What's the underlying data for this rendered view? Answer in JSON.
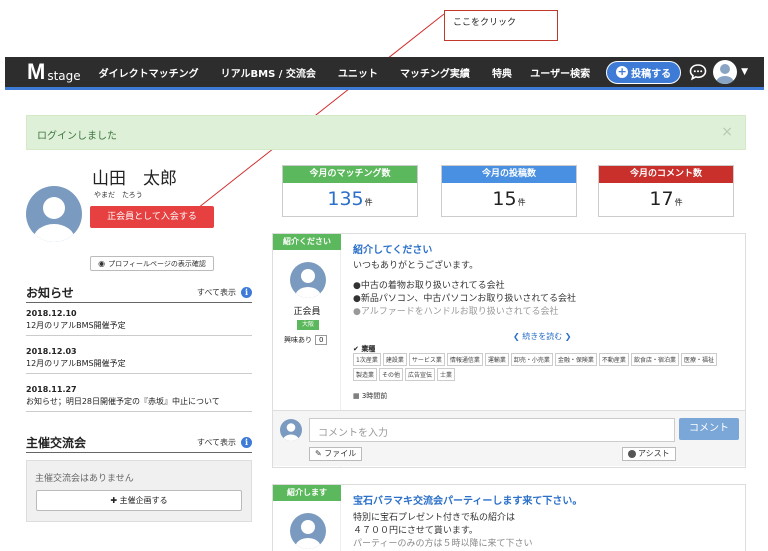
{
  "annotation": {
    "callout_text": "ここをクリック"
  },
  "navbar": {
    "logo_mark": "M",
    "logo_text": "stage",
    "links": [
      "ダイレクトマッチング",
      "リアルBMS / 交流会",
      "ユニット",
      "マッチング実績",
      "特典"
    ],
    "user_search": "ユーザー検索",
    "post_button": "投稿する"
  },
  "alert": {
    "message": "ログインしました",
    "close": "×"
  },
  "profile": {
    "name": "山田　太郎",
    "kana": "やまだ　たろう",
    "join_button": "正会員として入会する",
    "view_button": "プロフィールページの表示確認"
  },
  "news": {
    "title": "お知らせ",
    "all": "すべて表示",
    "items": [
      {
        "date": "2018.12.10",
        "text": "12月のリアルBMS開催予定"
      },
      {
        "date": "2018.12.03",
        "text": "12月のリアルBMS開催予定"
      },
      {
        "date": "2018.11.27",
        "text": "お知らせ；明日28日開催予定の『赤坂』中止について"
      }
    ]
  },
  "host": {
    "title": "主催交流会",
    "all": "すべて表示",
    "empty": "主催交流会はありません",
    "add_button": "主催企画する"
  },
  "stats": [
    {
      "label": "今月のマッチング数",
      "value": "135",
      "unit": "件",
      "color": "#5cb85c"
    },
    {
      "label": "今月の投稿数",
      "value": "15",
      "unit": "件",
      "color": "#4a90e2"
    },
    {
      "label": "今月のコメント数",
      "value": "17",
      "unit": "件",
      "color": "#c9302c"
    }
  ],
  "post1": {
    "tag": "紹介ください",
    "role": "正会員",
    "area": "大阪",
    "interest_label": "興味あり",
    "interest_count": "0",
    "title": "紹介してください",
    "greeting": "いつもありがとうございます。",
    "lines": [
      "●中古の着物お取り扱いされてる会社",
      "●新品パソコン、中古パソコンお取り扱いされてる会社",
      "●アルファードをハンドルお取り扱いされてる会社"
    ],
    "read_more": "続きを読む",
    "tags_label": "業種",
    "tags": [
      "1次産業",
      "建設業",
      "サービス業",
      "情報通信業",
      "運輸業",
      "卸売・小売業",
      "金融・保険業",
      "不動産業",
      "飲食店・宿泊業",
      "医療・福祉",
      "製造業",
      "その他",
      "広告宣伝",
      "士業"
    ],
    "time": "3時間前",
    "comment_placeholder": "コメントを入力",
    "comment_button": "コメント",
    "file_button": "ファイル",
    "assist_button": "アシスト"
  },
  "post2": {
    "tag": "紹介します",
    "title": "宝石バラマキ交流会パーティーします来て下さい。",
    "lines": [
      "特別に宝石プレゼント付きで私の紹介は",
      "４７００円にさせて貰います。",
      "パーティーのみの方は５時以降に来て下さい"
    ]
  }
}
